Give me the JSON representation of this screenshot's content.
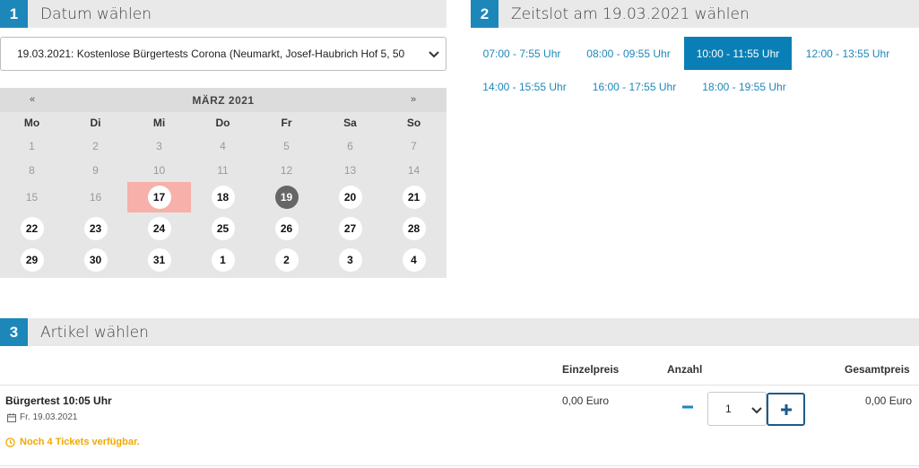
{
  "steps": [
    {
      "number": "1",
      "title": "Datum wählen"
    },
    {
      "number": "2",
      "title": "Zeitslot am 19.03.2021 wählen"
    },
    {
      "number": "3",
      "title": "Artikel wählen"
    }
  ],
  "event_select": {
    "value": "19.03.2021: Kostenlose Bürgertests Corona (Neumarkt, Josef-Haubrich Hof 5, 50"
  },
  "calendar": {
    "prev": "«",
    "next": "»",
    "month": "MÄRZ 2021",
    "weekdays": [
      "Mo",
      "Di",
      "Mi",
      "Do",
      "Fr",
      "Sa",
      "So"
    ],
    "weeks": [
      [
        "1",
        "2",
        "3",
        "4",
        "5",
        "6",
        "7"
      ],
      [
        "8",
        "9",
        "10",
        "11",
        "12",
        "13",
        "14"
      ],
      [
        "15",
        "16",
        "17",
        "18",
        "19",
        "20",
        "21"
      ],
      [
        "22",
        "23",
        "24",
        "25",
        "26",
        "27",
        "28"
      ],
      [
        "29",
        "30",
        "31",
        "1",
        "2",
        "3",
        "4"
      ]
    ],
    "today": "17",
    "selected": "19"
  },
  "timeslots": [
    {
      "label": "07:00 - 7:55 Uhr",
      "active": false
    },
    {
      "label": "08:00 - 09:55 Uhr",
      "active": false
    },
    {
      "label": "10:00 - 11:55 Uhr",
      "active": true
    },
    {
      "label": "12:00 - 13:55 Uhr",
      "active": false
    },
    {
      "label": "14:00 - 15:55 Uhr",
      "active": false
    },
    {
      "label": "16:00 - 17:55 Uhr",
      "active": false
    },
    {
      "label": "18:00 - 19:55 Uhr",
      "active": false
    }
  ],
  "table": {
    "headers": {
      "unit_price": "Einzelpreis",
      "quantity": "Anzahl",
      "total": "Gesamtpreis"
    },
    "product": {
      "name": "Bürgertest 10:05 Uhr",
      "date": "Fr. 19.03.2021",
      "availability": "Noch 4 Tickets verfügbar.",
      "unit_price": "0,00 Euro",
      "quantity": "1",
      "total": "0,00 Euro"
    }
  },
  "icons": {
    "calendar": "calendar-icon",
    "clock": "clock-icon",
    "minus": "minus-icon",
    "plus": "plus-icon",
    "chevron": "chevron-down-icon"
  },
  "colors": {
    "accent": "#1d87b9",
    "active_slot": "#0a7fb5",
    "today": "#f7b0aa",
    "warning": "#f0a800"
  }
}
